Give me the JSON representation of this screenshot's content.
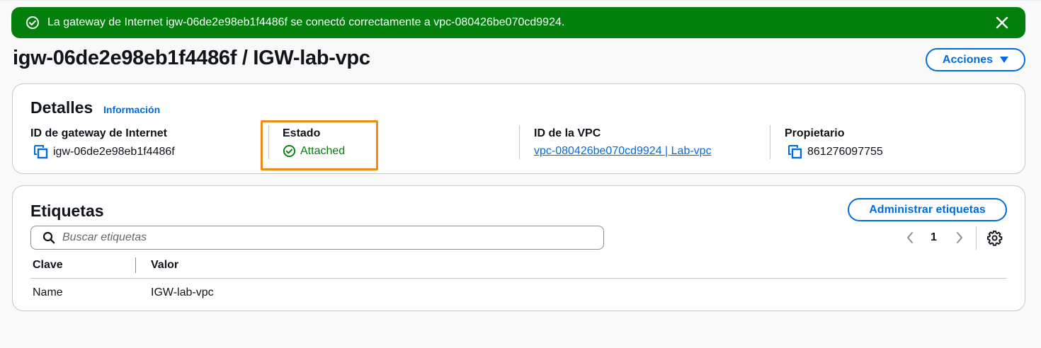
{
  "flash": {
    "message": "La gateway de Internet igw-06de2e98eb1f4486f se conectó correctamente a vpc-080426be070cd9924.",
    "type": "success",
    "color": "#037f0c"
  },
  "page": {
    "title": "igw-06de2e98eb1f4486f / IGW-lab-vpc",
    "actions_label": "Acciones"
  },
  "details": {
    "heading": "Detalles",
    "info_label": "Información",
    "fields": {
      "igw_id": {
        "label": "ID de gateway de Internet",
        "value": "igw-06de2e98eb1f4486f"
      },
      "state": {
        "label": "Estado",
        "value": "Attached"
      },
      "vpc_id": {
        "label": "ID de la VPC",
        "value": "vpc-080426be070cd9924 | Lab-vpc"
      },
      "owner": {
        "label": "Propietario",
        "value": "861276097755"
      }
    }
  },
  "tags": {
    "heading": "Etiquetas",
    "manage_label": "Administrar etiquetas",
    "search_placeholder": "Buscar etiquetas",
    "page": "1",
    "columns": [
      "Clave",
      "Valor"
    ],
    "rows": [
      {
        "key": "Name",
        "value": "IGW-lab-vpc"
      }
    ]
  },
  "colors": {
    "accent": "#006ce0",
    "success": "#037f0c",
    "highlight": "#ec8c14"
  }
}
